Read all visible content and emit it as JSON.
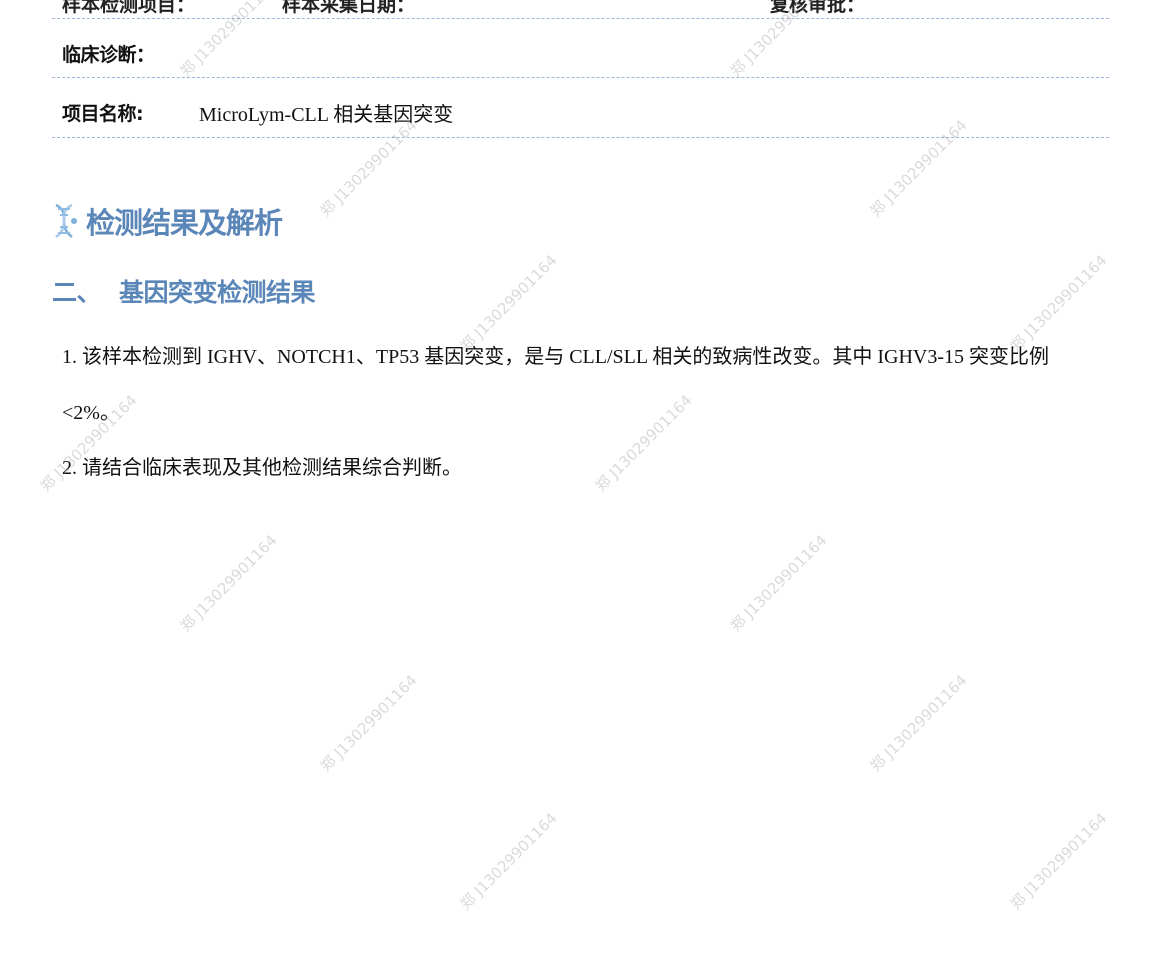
{
  "info": {
    "row_top_left": "样本检测项目：",
    "row_top_mid": "样本采集日期：",
    "row_top_right": "复核审批：",
    "clinical_diagnosis_label": "临床诊断：",
    "clinical_diagnosis_value": "",
    "project_name_label": "项目名称:",
    "project_name_value": "MicroLym-CLL 相关基因突变"
  },
  "section": {
    "title": "检测结果及解析",
    "icon": "dna-icon",
    "subtitle_number": "二、",
    "subtitle_text": "基因突变检测结果"
  },
  "results": {
    "item1": "1. 该样本检测到 IGHV、NOTCH1、TP53 基因突变，是与 CLL/SLL 相关的致病性改变。其中 IGHV3-15 突变比例<2%。",
    "item2": "2. 请结合临床表现及其他检测结果综合判断。"
  },
  "watermark": {
    "text": "郑 J13029901164",
    "color": "#969696"
  },
  "colors": {
    "accent": "#5a86b8",
    "divider": "#9bb6d6"
  }
}
